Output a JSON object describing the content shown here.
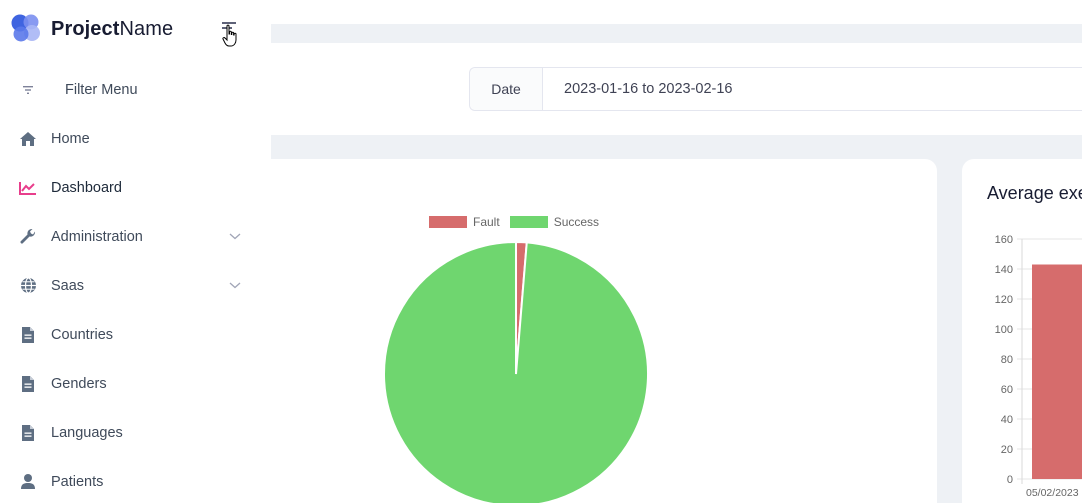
{
  "brand": {
    "name_bold": "Project",
    "name_rest": "Name"
  },
  "nav": {
    "filter_label": "Filter Menu",
    "items": [
      {
        "label": "Home",
        "icon": "home-icon"
      },
      {
        "label": "Dashboard",
        "icon": "chart-line-icon",
        "active": true
      },
      {
        "label": "Administration",
        "icon": "wrench-icon",
        "expandable": true
      },
      {
        "label": "Saas",
        "icon": "globe-icon",
        "expandable": true
      },
      {
        "label": "Countries",
        "icon": "file-icon"
      },
      {
        "label": "Genders",
        "icon": "file-icon"
      },
      {
        "label": "Languages",
        "icon": "file-icon"
      },
      {
        "label": "Patients",
        "icon": "user-icon"
      }
    ]
  },
  "filter": {
    "date_label": "Date",
    "date_value": "2023-01-16 to 2023-02-16"
  },
  "cards": {
    "right_title": "Average exe"
  },
  "colors": {
    "fault": "#d66c6c",
    "success": "#6fd66f",
    "accent": "#e83e8c"
  },
  "chart_data": [
    {
      "type": "pie",
      "labels": [
        "Fault",
        "Success"
      ],
      "values": [
        1.3,
        98.7
      ],
      "legend": "top"
    },
    {
      "type": "bar",
      "categories": [
        "05/02/2023"
      ],
      "values": [
        143
      ],
      "ylim": [
        0,
        160
      ],
      "yticks": [
        0,
        20,
        40,
        60,
        80,
        100,
        120,
        140,
        160
      ],
      "grid": true
    }
  ]
}
